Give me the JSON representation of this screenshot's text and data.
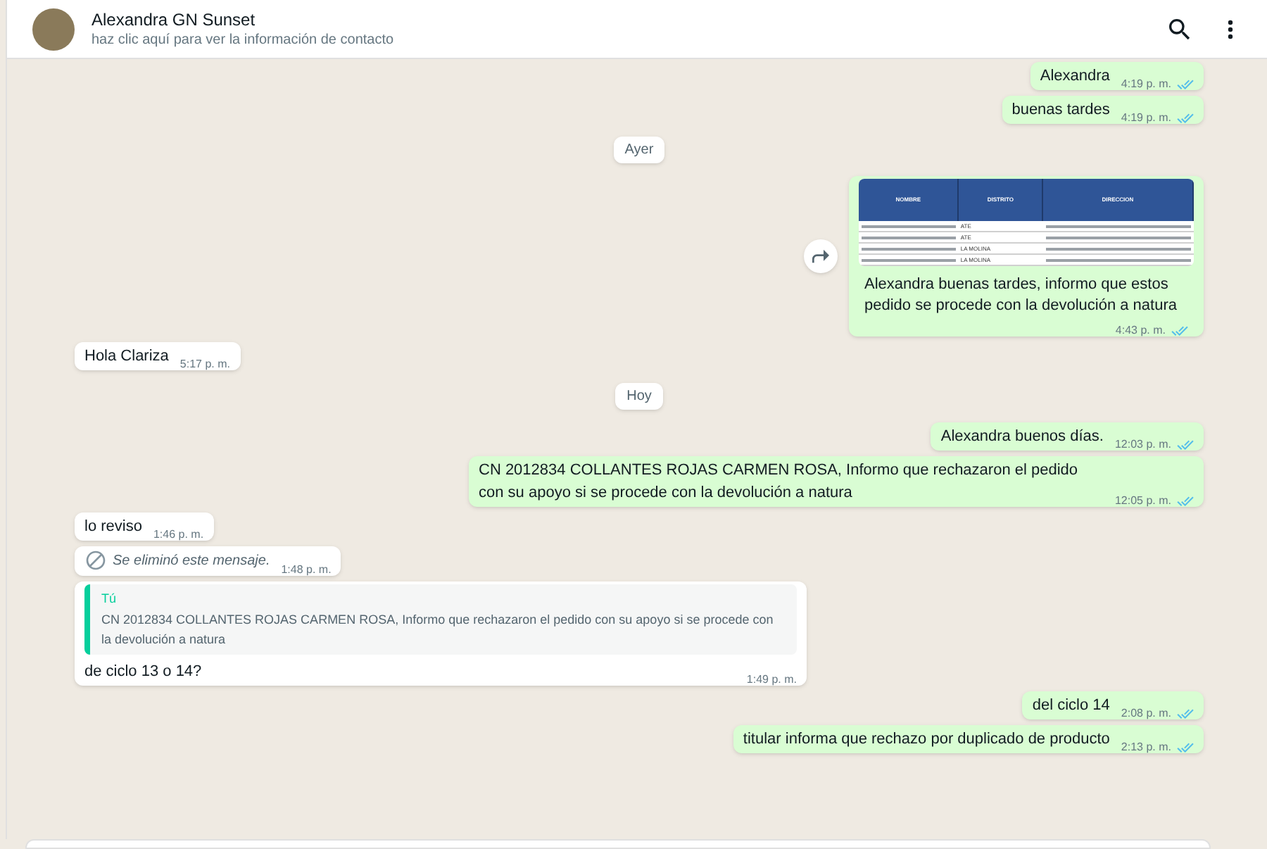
{
  "header": {
    "name": "Alexandra GN Sunset",
    "subtitle": "haz clic aquí para ver la información de contacto"
  },
  "messages": [
    {
      "kind": "text",
      "outgoing": true,
      "text": "Alexandra",
      "time": "4:19 p. m.",
      "read": true
    },
    {
      "kind": "text",
      "outgoing": true,
      "text": "buenas tardes",
      "time": "4:19 p. m.",
      "read": true
    },
    {
      "kind": "date",
      "text": "Ayer"
    },
    {
      "kind": "image",
      "outgoing": true,
      "table": {
        "columns": [
          "NOMBRE",
          "DISTRITO",
          "DIRECCION"
        ],
        "rows": [
          [
            "ATE"
          ],
          [
            "ATE"
          ],
          [
            "LA MOLINA"
          ],
          [
            "LA MOLINA"
          ]
        ]
      },
      "text": "Alexandra buenas tardes, informo que estos pedido se procede con la devolución a natura",
      "time": "4:43 p. m.",
      "read": true
    },
    {
      "kind": "text",
      "outgoing": false,
      "text": "Hola Clariza",
      "time": "5:17 p. m."
    },
    {
      "kind": "date",
      "text": "Hoy"
    },
    {
      "kind": "text",
      "outgoing": true,
      "text": "Alexandra buenos días.",
      "time": "12:03 p. m.",
      "read": true
    },
    {
      "kind": "text",
      "outgoing": true,
      "text": "CN 2012834  COLLANTES ROJAS CARMEN ROSA, Informo que rechazaron el pedido con su apoyo si se procede con la devolución a natura",
      "time": "12:05 p. m.",
      "read": true
    },
    {
      "kind": "text",
      "outgoing": false,
      "text": "lo reviso",
      "time": "1:46 p. m."
    },
    {
      "kind": "deleted",
      "outgoing": false,
      "text": "Se eliminó este mensaje.",
      "time": "1:48 p. m."
    },
    {
      "kind": "quote",
      "outgoing": false,
      "quote_author": "Tú",
      "quote_text": "CN 2012834  COLLANTES ROJAS CARMEN ROSA, Informo que rechazaron el pedido con su apoyo si se procede con la devolución a natura",
      "text": "de ciclo 13 o 14?",
      "time": "1:49 p. m."
    },
    {
      "kind": "text",
      "outgoing": true,
      "text": "del ciclo 14",
      "time": "2:08 p. m.",
      "read": true
    },
    {
      "kind": "text",
      "outgoing": true,
      "text": "titular informa que rechazo por duplicado de producto",
      "time": "2:13 p. m.",
      "read": true
    }
  ]
}
